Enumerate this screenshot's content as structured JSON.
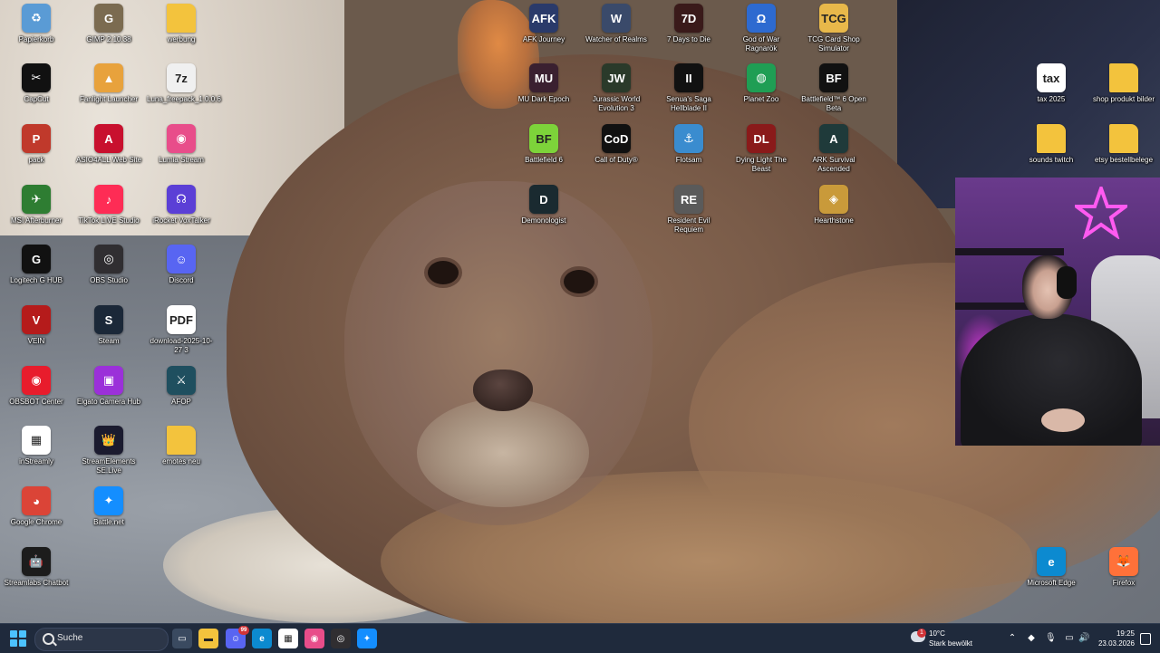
{
  "desktop": {
    "icons": [
      {
        "label": "Papierkorb",
        "icon": "recycle-bin-icon",
        "color": "#5a9bd5",
        "glyph": "♻"
      },
      {
        "label": "GIMP 2.10.38",
        "icon": "gimp-icon",
        "color": "#7b6b50",
        "glyph": "G"
      },
      {
        "label": "werbung",
        "icon": "folder-icon",
        "color": "#f3c33d",
        "glyph": ""
      },
      {
        "label": "CapCut",
        "icon": "capcut-icon",
        "color": "#111111",
        "glyph": "✂"
      },
      {
        "label": "Fanlight Launcher",
        "icon": "fanlight-launcher-icon",
        "color": "#e8a23c",
        "glyph": "▲"
      },
      {
        "label": "Luna_freepack_1.0.0.6",
        "icon": "archive-7z-icon",
        "color": "#f0f0f0",
        "glyph": "7z"
      },
      {
        "label": "pack",
        "icon": "pack-image-icon",
        "color": "#c0392b",
        "glyph": "P"
      },
      {
        "label": "ASIO4ALL Web Site",
        "icon": "asio4all-icon",
        "color": "#c8102e",
        "glyph": "A"
      },
      {
        "label": "Lumia Stream",
        "icon": "lumia-stream-icon",
        "color": "#e84d8a",
        "glyph": "◉"
      },
      {
        "label": "MSI Afterburner",
        "icon": "msi-afterburner-icon",
        "color": "#2e7d32",
        "glyph": "✈"
      },
      {
        "label": "TikTok LIVE Studio",
        "icon": "tiktok-live-studio-icon",
        "color": "#fe2c55",
        "glyph": "♪"
      },
      {
        "label": "iRocket VoxTalker",
        "icon": "voxtalker-icon",
        "color": "#5b3fd6",
        "glyph": "☊"
      },
      {
        "label": "Logitech G HUB",
        "icon": "logitech-g-hub-icon",
        "color": "#111111",
        "glyph": "G"
      },
      {
        "label": "OBS Studio",
        "icon": "obs-studio-icon",
        "color": "#302e31",
        "glyph": "◎"
      },
      {
        "label": "Discord",
        "icon": "discord-icon",
        "color": "#5865f2",
        "glyph": "☺"
      },
      {
        "label": "VEIN",
        "icon": "vein-game-icon",
        "color": "#b51b1b",
        "glyph": "V"
      },
      {
        "label": "Steam",
        "icon": "steam-icon",
        "color": "#1b2838",
        "glyph": "S"
      },
      {
        "label": "download-2025-10-27 3",
        "icon": "pdf-file-icon",
        "color": "#ffffff",
        "glyph": "PDF"
      },
      {
        "label": "OBSBOT Center",
        "icon": "obsbot-center-icon",
        "color": "#e81c2c",
        "glyph": "◉"
      },
      {
        "label": "Elgato Camera Hub",
        "icon": "elgato-camera-hub-icon",
        "color": "#9b30d9",
        "glyph": "▣"
      },
      {
        "label": "AFOP",
        "icon": "afop-game-icon",
        "color": "#1f4f5f",
        "glyph": "⚔"
      },
      {
        "label": "inStreamly",
        "icon": "instreamly-icon",
        "color": "#ffffff",
        "glyph": "▦"
      },
      {
        "label": "StreamElements SE.Live",
        "icon": "streamelements-icon",
        "color": "#1b1b2f",
        "glyph": "👑"
      },
      {
        "label": "emotes neu",
        "icon": "folder-emotes-icon",
        "color": "#f3c33d",
        "glyph": ""
      },
      {
        "label": "Google Chrome",
        "icon": "chrome-icon",
        "color": "#db4437",
        "glyph": "◕"
      },
      {
        "label": "Battle.net",
        "icon": "battle-net-icon",
        "color": "#148eff",
        "glyph": "✦"
      },
      {
        "label": "Streamlabs Chatbot",
        "icon": "streamlabs-chatbot-icon",
        "color": "#1c1c1c",
        "glyph": "🤖"
      },
      {
        "label": "AFK Journey",
        "icon": "afk-journey-icon",
        "color": "#2a3a6a",
        "glyph": "AFK"
      },
      {
        "label": "Watcher of Realms",
        "icon": "watcher-of-realms-icon",
        "color": "#3a4a6a",
        "glyph": "W"
      },
      {
        "label": "7 Days to Die",
        "icon": "7-days-to-die-icon",
        "color": "#3a1a1a",
        "glyph": "7D"
      },
      {
        "label": "God of War Ragnarök",
        "icon": "god-of-war-icon",
        "color": "#2d6ad0",
        "glyph": "Ω"
      },
      {
        "label": "TCG Card Shop Simulator",
        "icon": "tcg-card-shop-icon",
        "color": "#e8b84a",
        "glyph": "TCG"
      },
      {
        "label": "MU Dark Epoch",
        "icon": "mu-dark-epoch-icon",
        "color": "#3a2030",
        "glyph": "MU"
      },
      {
        "label": "Jurassic World Evolution 3",
        "icon": "jurassic-world-icon",
        "color": "#2a3a2a",
        "glyph": "JW"
      },
      {
        "label": "Senua's Saga Hellblade II",
        "icon": "hellblade-icon",
        "color": "#111111",
        "glyph": "II"
      },
      {
        "label": "Planet Zoo",
        "icon": "planet-zoo-icon",
        "color": "#1f9e54",
        "glyph": "◍"
      },
      {
        "label": "Battlefield™ 6 Open Beta",
        "icon": "battlefield-6-beta-icon",
        "color": "#111111",
        "glyph": "BF"
      },
      {
        "label": "Battlefield 6",
        "icon": "battlefield-6-icon",
        "color": "#7dd33a",
        "glyph": "BF"
      },
      {
        "label": "Call of Duty®",
        "icon": "call-of-duty-icon",
        "color": "#111111",
        "glyph": "CoD"
      },
      {
        "label": "Flotsam",
        "icon": "flotsam-icon",
        "color": "#3a8ccf",
        "glyph": "⚓"
      },
      {
        "label": "Dying Light The Beast",
        "icon": "dying-light-icon",
        "color": "#8a1a1a",
        "glyph": "DL"
      },
      {
        "label": "ARK Survival Ascended",
        "icon": "ark-survival-icon",
        "color": "#1f3a3a",
        "glyph": "A"
      },
      {
        "label": "Demonologist",
        "icon": "demonologist-icon",
        "color": "#1a2a30",
        "glyph": "D"
      },
      {
        "label": "Resident Evil Requiem",
        "icon": "resident-evil-icon",
        "color": "#5a5a5a",
        "glyph": "RE"
      },
      {
        "label": "Hearthstone",
        "icon": "hearthstone-icon",
        "color": "#c99a3a",
        "glyph": "◈"
      },
      {
        "label": "tax 2025",
        "icon": "tax-2025-icon",
        "color": "#ffffff",
        "glyph": "tax"
      },
      {
        "label": "shop produkt bilder",
        "icon": "folder-shop-icon",
        "color": "#f3c33d",
        "glyph": ""
      },
      {
        "label": "sounds twitch",
        "icon": "folder-sounds-icon",
        "color": "#f3c33d",
        "glyph": ""
      },
      {
        "label": "etsy bestellbelege",
        "icon": "folder-etsy-icon",
        "color": "#f3c33d",
        "glyph": ""
      },
      {
        "label": "Microsoft Edge",
        "icon": "edge-icon",
        "color": "#0c8ad0",
        "glyph": "e"
      },
      {
        "label": "Firefox",
        "icon": "firefox-icon",
        "color": "#ff7139",
        "glyph": "🦊"
      }
    ]
  },
  "taskbar": {
    "search_placeholder": "Suche",
    "pinned": [
      {
        "icon": "task-view-icon",
        "color": "#3a4a60",
        "glyph": "▭"
      },
      {
        "icon": "file-explorer-icon",
        "color": "#f3c33d",
        "glyph": "▬"
      },
      {
        "icon": "discord-icon",
        "color": "#5865f2",
        "glyph": "☺",
        "badge": "99"
      },
      {
        "icon": "edge-icon",
        "color": "#0c8ad0",
        "glyph": "e"
      },
      {
        "icon": "instreamly-icon",
        "color": "#ffffff",
        "glyph": "▦"
      },
      {
        "icon": "lumia-stream-icon",
        "color": "#e84d8a",
        "glyph": "◉"
      },
      {
        "icon": "obs-studio-icon",
        "color": "#302e31",
        "glyph": "◎"
      },
      {
        "icon": "battle-net-icon",
        "color": "#148eff",
        "glyph": "✦"
      }
    ],
    "weather": {
      "temp": "10°C",
      "condition": "Stark bewölkt",
      "alert": "1"
    },
    "clock": {
      "time": "19:25",
      "date": "23.03.2026"
    },
    "accent": "#4cc2ff"
  }
}
